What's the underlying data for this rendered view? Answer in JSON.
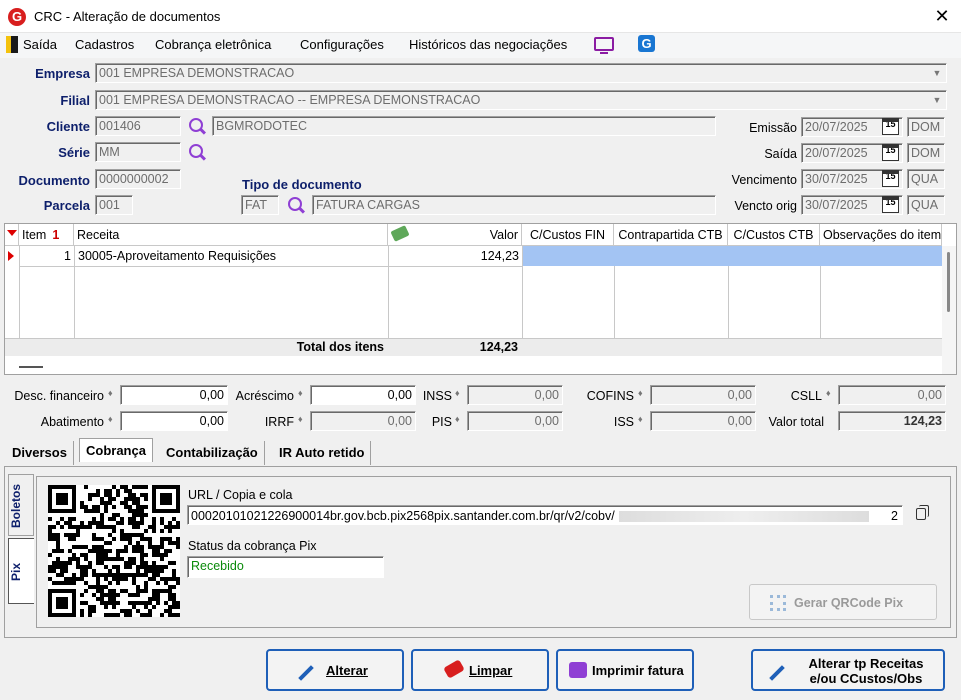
{
  "window": {
    "title": "CRC - Alteração de documentos",
    "app_icon": "G",
    "close": "✕"
  },
  "menu": [
    "Saída",
    "Cadastros",
    "Cobrança eletrônica",
    "Configurações",
    "Históricos das negociações"
  ],
  "header": {
    "empresa": {
      "label": "Empresa",
      "value": "001 EMPRESA DEMONSTRACAO"
    },
    "filial": {
      "label": "Filial",
      "value": "001 EMPRESA DEMONSTRACAO -- EMPRESA DEMONSTRACAO"
    },
    "cliente": {
      "label": "Cliente",
      "code": "001406",
      "name": "BGMRODOTEC"
    },
    "serie": {
      "label": "Série",
      "value": "MM"
    },
    "documento": {
      "label": "Documento",
      "value": "0000000002"
    },
    "parcela": {
      "label": "Parcela",
      "value": "001"
    },
    "tipo_documento": {
      "label": "Tipo de documento",
      "code": "FAT",
      "name": "FATURA CARGAS"
    },
    "emissao": {
      "label": "Emissão",
      "date": "20/07/2025",
      "day": "DOM"
    },
    "saida": {
      "label": "Saída",
      "date": "20/07/2025",
      "day": "DOM"
    },
    "vencimento": {
      "label": "Vencimento",
      "date": "30/07/2025",
      "day": "QUA"
    },
    "vencto_orig": {
      "label": "Vencto orig",
      "date": "30/07/2025",
      "day": "QUA"
    },
    "calendar_glyph": "15"
  },
  "grid": {
    "columns": [
      "Item",
      "Receita",
      "Valor",
      "C/Custos FIN",
      "Contrapartida CTB",
      "C/Custos CTB",
      "Observações do item"
    ],
    "item_sort_glyph": "1",
    "rows": [
      {
        "item": "1",
        "receita": "30005-Aproveitamento Requisições",
        "valor": "124,23"
      }
    ],
    "total_label": "Total dos itens",
    "total_value": "124,23"
  },
  "totals": {
    "desc_financeiro": {
      "label": "Desc. financeiro",
      "value": "0,00"
    },
    "acrescimo": {
      "label": "Acréscimo",
      "value": "0,00"
    },
    "inss": {
      "label": "INSS",
      "value": "0,00"
    },
    "cofins": {
      "label": "COFINS",
      "value": "0,00"
    },
    "csll": {
      "label": "CSLL",
      "value": "0,00"
    },
    "abatimento": {
      "label": "Abatimento",
      "value": "0,00"
    },
    "irrf": {
      "label": "IRRF",
      "value": "0,00"
    },
    "pis": {
      "label": "PIS",
      "value": "0,00"
    },
    "iss": {
      "label": "ISS",
      "value": "0,00"
    },
    "valor_total": {
      "label": "Valor total",
      "value": "124,23"
    }
  },
  "tabs": [
    "Diversos",
    "Cobrança",
    "Contabilização",
    "IR Auto retido"
  ],
  "cobranca": {
    "side_tabs": [
      "Boletos",
      "Pix"
    ],
    "url_label": "URL / Copia e cola",
    "url_value": "00020101021226900014br.gov.bcb.pix2568pix.santander.com.br/qr/v2/cobv/",
    "url_tail": "2",
    "status_label": "Status da cobrança Pix",
    "status_value": "Recebido",
    "gerar_label": "Gerar QRCode Pix"
  },
  "buttons": {
    "alterar": "Alterar",
    "limpar": "Limpar",
    "imprimir": "Imprimir fatura",
    "alterar_tp_1": "Alterar tp Receitas",
    "alterar_tp_2": "e/ou CCustos/Obs"
  },
  "colors": {
    "label_blue": "#0d1f6b",
    "selected_row": "#a3c4f3",
    "status_green": "#0a8a0a",
    "button_border": "#1e5fb8"
  }
}
